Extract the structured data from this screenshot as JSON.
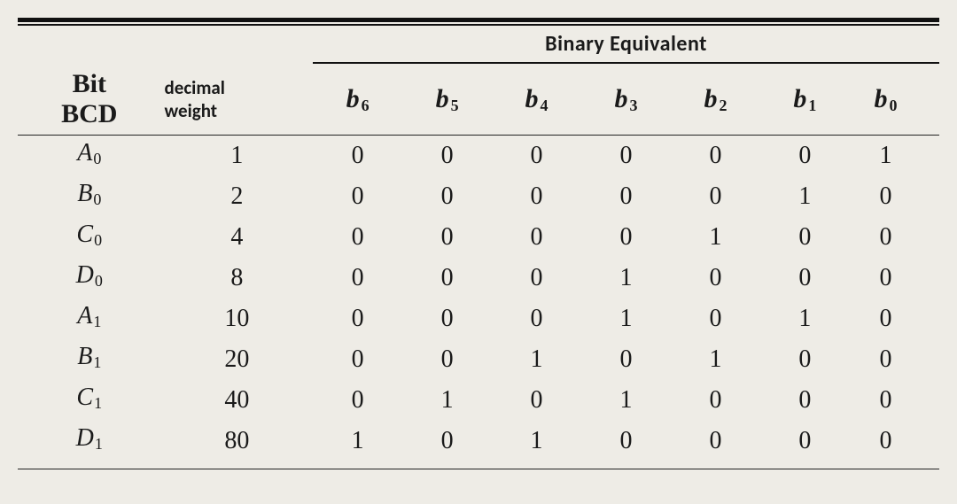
{
  "header": {
    "stub_line1": "Bit",
    "stub_line2": "BCD",
    "decimal_line1": "decimal",
    "decimal_line2": "weight",
    "spanner": "Binary Equivalent",
    "b_cols": [
      {
        "letter": "b",
        "sub": "6"
      },
      {
        "letter": "b",
        "sub": "5"
      },
      {
        "letter": "b",
        "sub": "4"
      },
      {
        "letter": "b",
        "sub": "3"
      },
      {
        "letter": "b",
        "sub": "2"
      },
      {
        "letter": "b",
        "sub": "1"
      },
      {
        "letter": "b",
        "sub": "0"
      }
    ]
  },
  "rows": [
    {
      "bit_letter": "A",
      "bit_sub": "0",
      "decimal": "1",
      "b": [
        "0",
        "0",
        "0",
        "0",
        "0",
        "0",
        "1"
      ]
    },
    {
      "bit_letter": "B",
      "bit_sub": "0",
      "decimal": "2",
      "b": [
        "0",
        "0",
        "0",
        "0",
        "0",
        "1",
        "0"
      ]
    },
    {
      "bit_letter": "C",
      "bit_sub": "0",
      "decimal": "4",
      "b": [
        "0",
        "0",
        "0",
        "0",
        "1",
        "0",
        "0"
      ]
    },
    {
      "bit_letter": "D",
      "bit_sub": "0",
      "decimal": "8",
      "b": [
        "0",
        "0",
        "0",
        "1",
        "0",
        "0",
        "0"
      ]
    },
    {
      "bit_letter": "A",
      "bit_sub": "1",
      "decimal": "10",
      "b": [
        "0",
        "0",
        "0",
        "1",
        "0",
        "1",
        "0"
      ]
    },
    {
      "bit_letter": "B",
      "bit_sub": "1",
      "decimal": "20",
      "b": [
        "0",
        "0",
        "1",
        "0",
        "1",
        "0",
        "0"
      ]
    },
    {
      "bit_letter": "C",
      "bit_sub": "1",
      "decimal": "40",
      "b": [
        "0",
        "1",
        "0",
        "1",
        "0",
        "0",
        "0"
      ]
    },
    {
      "bit_letter": "D",
      "bit_sub": "1",
      "decimal": "80",
      "b": [
        "1",
        "0",
        "1",
        "0",
        "0",
        "0",
        "0"
      ]
    }
  ],
  "chart_data": {
    "type": "table",
    "title": "BCD bit decimal weights and their 7-bit binary equivalents",
    "columns": [
      "Bit BCD",
      "decimal weight",
      "b6",
      "b5",
      "b4",
      "b3",
      "b2",
      "b1",
      "b0"
    ],
    "rows": [
      [
        "A0",
        1,
        0,
        0,
        0,
        0,
        0,
        0,
        1
      ],
      [
        "B0",
        2,
        0,
        0,
        0,
        0,
        0,
        1,
        0
      ],
      [
        "C0",
        4,
        0,
        0,
        0,
        0,
        1,
        0,
        0
      ],
      [
        "D0",
        8,
        0,
        0,
        0,
        1,
        0,
        0,
        0
      ],
      [
        "A1",
        10,
        0,
        0,
        0,
        1,
        0,
        1,
        0
      ],
      [
        "B1",
        20,
        0,
        0,
        1,
        0,
        1,
        0,
        0
      ],
      [
        "C1",
        40,
        0,
        1,
        0,
        1,
        0,
        0,
        0
      ],
      [
        "D1",
        80,
        1,
        0,
        1,
        0,
        0,
        0,
        0
      ]
    ]
  }
}
